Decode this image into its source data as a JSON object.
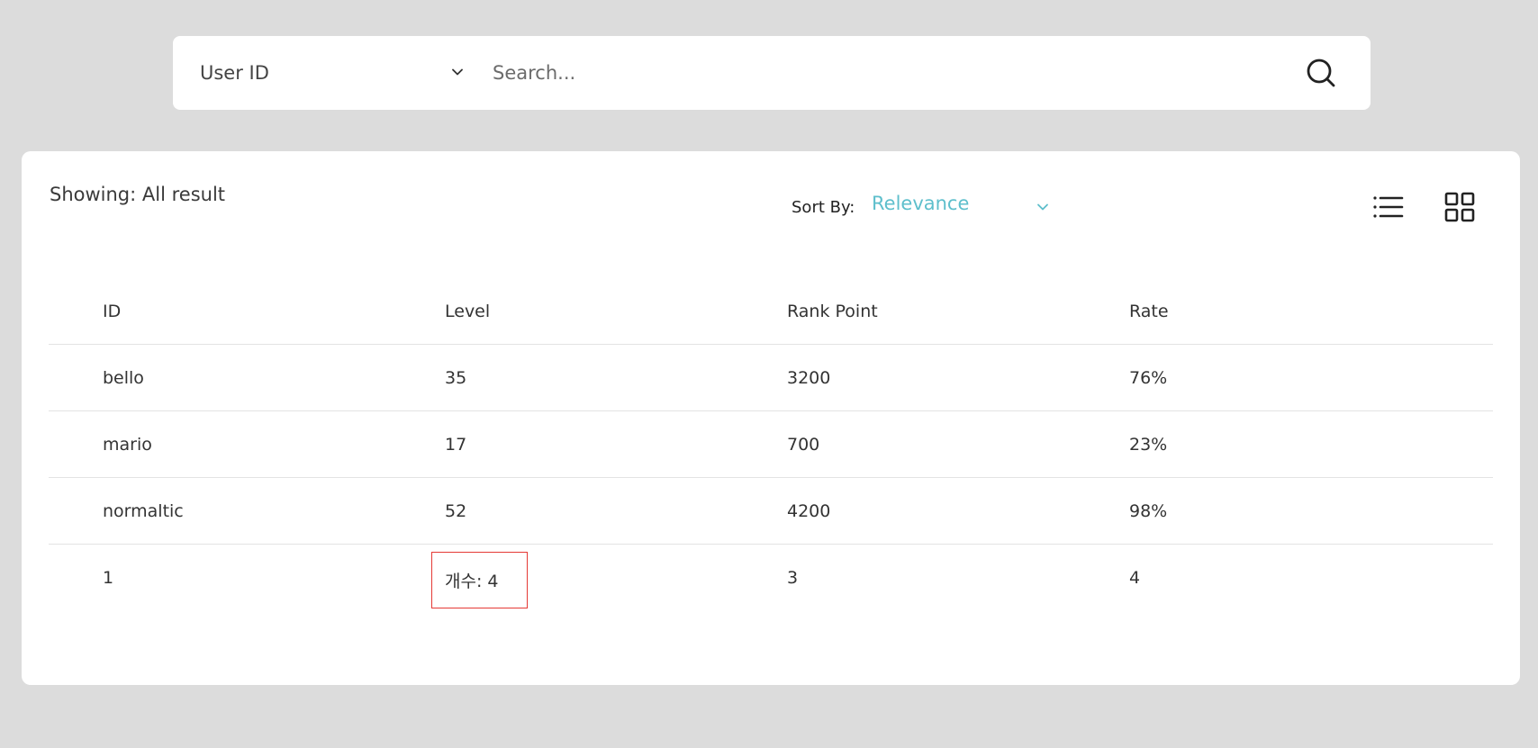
{
  "search": {
    "filter_value": "User ID",
    "placeholder": "Search...",
    "filter_icon": "chevron-down-icon",
    "search_icon": "search-icon"
  },
  "results": {
    "showing_label": "Showing: All result",
    "sort_label": "Sort By:",
    "sort_value": "Relevance",
    "sort_color": "#5ebfcc",
    "view_icons": [
      "list-view-icon",
      "grid-view-icon"
    ]
  },
  "table": {
    "columns": [
      "ID",
      "Level",
      "Rank Point",
      "Rate"
    ],
    "rows": [
      [
        "bello",
        "35",
        "3200",
        "76%"
      ],
      [
        "mario",
        "17",
        "700",
        "23%"
      ],
      [
        "normaltic",
        "52",
        "4200",
        "98%"
      ],
      [
        "1",
        "개수: 4",
        "3",
        "4"
      ]
    ],
    "highlight_color": "#e53935"
  }
}
